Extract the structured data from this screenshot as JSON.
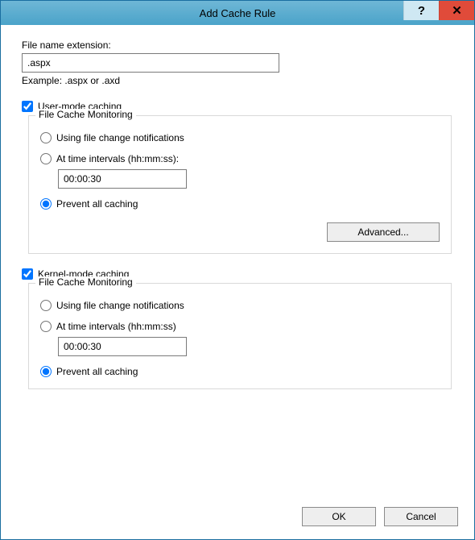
{
  "titlebar": {
    "title": "Add Cache Rule",
    "help_glyph": "?",
    "close_glyph": "✕"
  },
  "file_ext": {
    "label": "File name extension:",
    "value": ".aspx",
    "example": "Example: .aspx or .axd"
  },
  "user_mode": {
    "checkbox_label": "User-mode caching",
    "checked": true,
    "group_title": "File Cache Monitoring",
    "opt_notify_label": "Using file change notifications",
    "opt_interval_label": "At time intervals (hh:mm:ss):",
    "interval_value": "00:00:30",
    "opt_prevent_label": "Prevent all caching",
    "selected": "prevent",
    "advanced_label": "Advanced..."
  },
  "kernel_mode": {
    "checkbox_label": "Kernel-mode caching",
    "checked": true,
    "group_title": "File Cache Monitoring",
    "opt_notify_label": "Using file change notifications",
    "opt_interval_label": "At time intervals (hh:mm:ss)",
    "interval_value": "00:00:30",
    "opt_prevent_label": "Prevent all caching",
    "selected": "prevent"
  },
  "footer": {
    "ok": "OK",
    "cancel": "Cancel"
  }
}
